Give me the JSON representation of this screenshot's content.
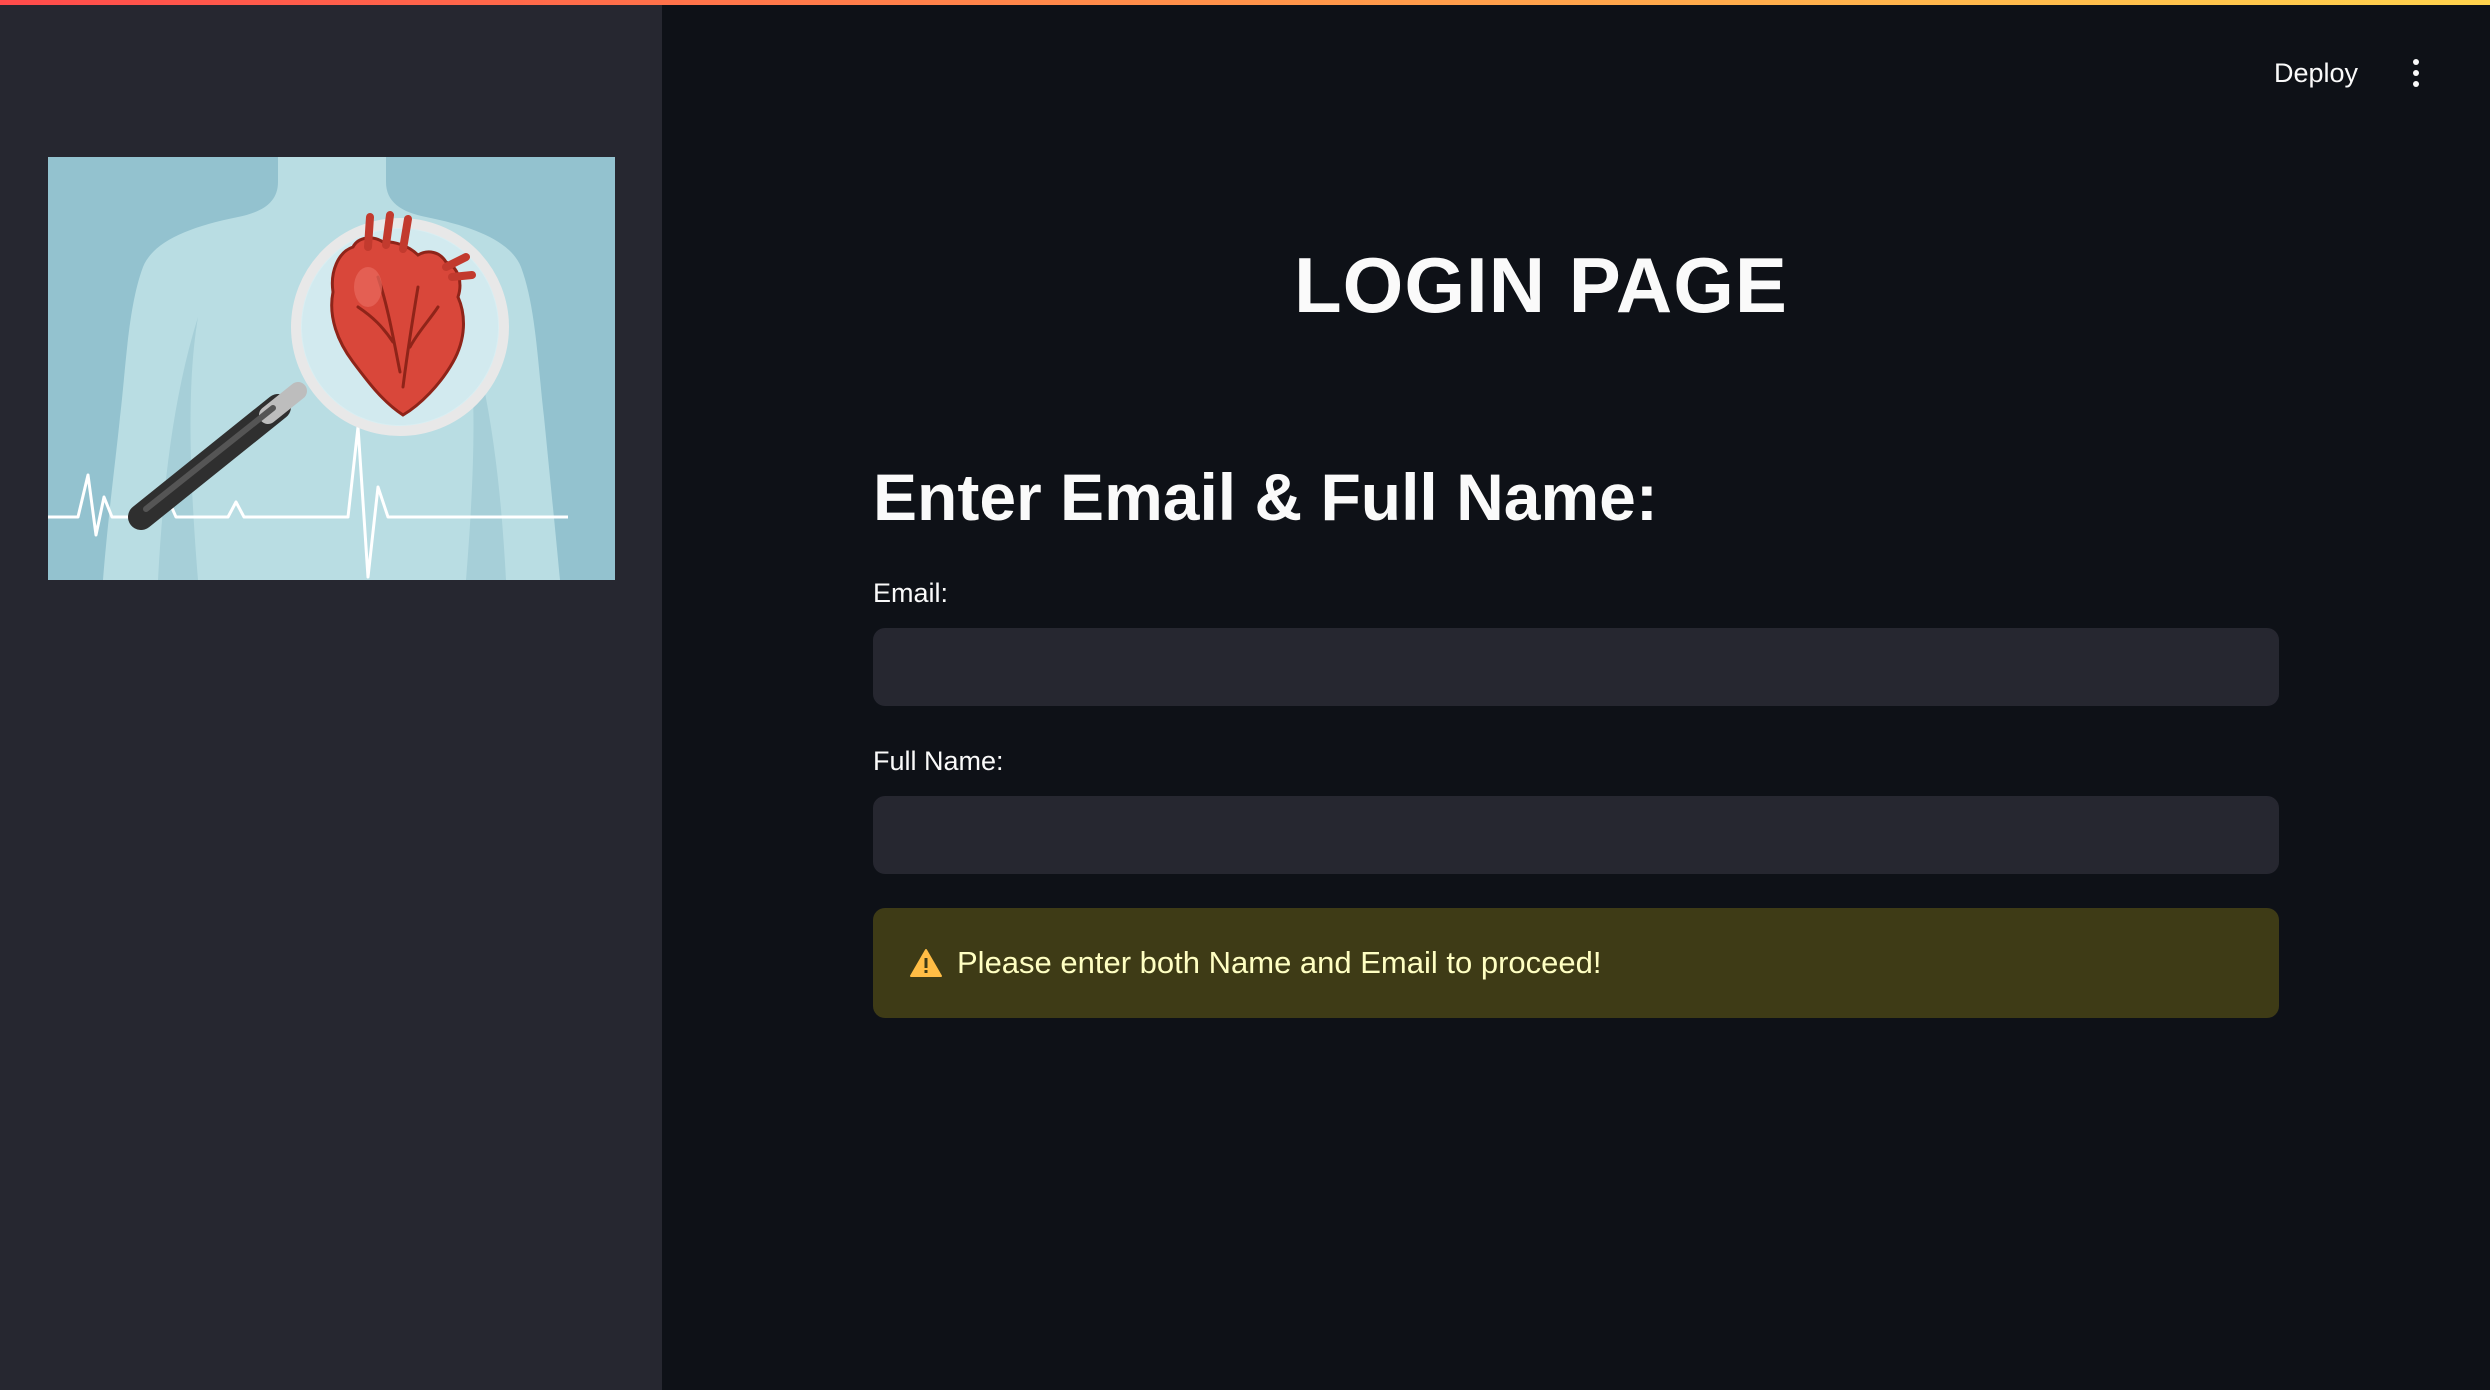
{
  "app": {
    "accent_gradient": [
      "#ff4b4b",
      "#ffd34d"
    ]
  },
  "header": {
    "deploy_label": "Deploy",
    "menu_icon": "vertical-dots-icon"
  },
  "sidebar": {
    "image": {
      "description_icon": "heart-magnifier-illustration"
    }
  },
  "main": {
    "title": "LOGIN PAGE",
    "subheader": "Enter Email & Full Name:",
    "email": {
      "label": "Email:",
      "value": "",
      "placeholder": ""
    },
    "full_name": {
      "label": "Full Name:",
      "value": "",
      "placeholder": ""
    },
    "warning": {
      "icon": "warning-triangle-icon",
      "text": "Please enter both Name and Email to proceed!",
      "color": "#ffffc2",
      "background": "#3e3b16"
    }
  }
}
